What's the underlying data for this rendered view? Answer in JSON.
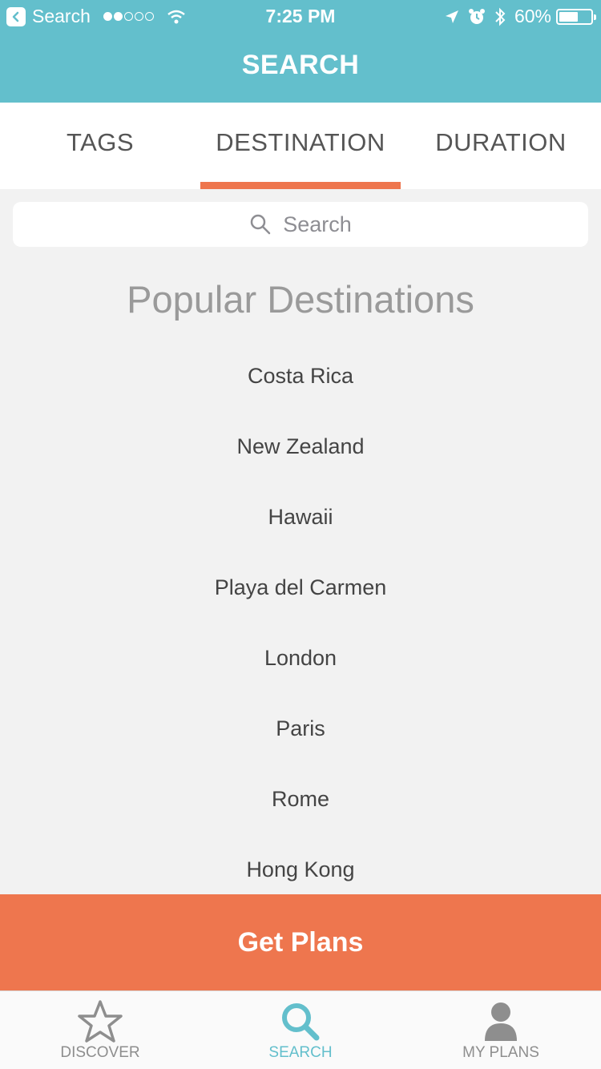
{
  "status_bar": {
    "back_app": "Search",
    "time": "7:25 PM",
    "battery_percent": "60%",
    "battery_level": 0.6
  },
  "header": {
    "title": "SEARCH"
  },
  "tabs": [
    {
      "label": "TAGS"
    },
    {
      "label": "DESTINATION",
      "active": true
    },
    {
      "label": "DURATION"
    }
  ],
  "search": {
    "placeholder": "Search"
  },
  "popular": {
    "title": "Popular Destinations",
    "items": [
      "Costa Rica",
      "New Zealand",
      "Hawaii",
      "Playa del Carmen",
      "London",
      "Paris",
      "Rome",
      "Hong Kong"
    ]
  },
  "cta": {
    "label": "Get Plans"
  },
  "tabbar": {
    "items": [
      {
        "label": "DISCOVER",
        "icon": "star-icon"
      },
      {
        "label": "SEARCH",
        "icon": "search-icon",
        "active": true
      },
      {
        "label": "MY PLANS",
        "icon": "person-icon"
      }
    ]
  },
  "colors": {
    "header": "#63bfcc",
    "accent": "#ee764e",
    "background": "#f2f2f2"
  }
}
